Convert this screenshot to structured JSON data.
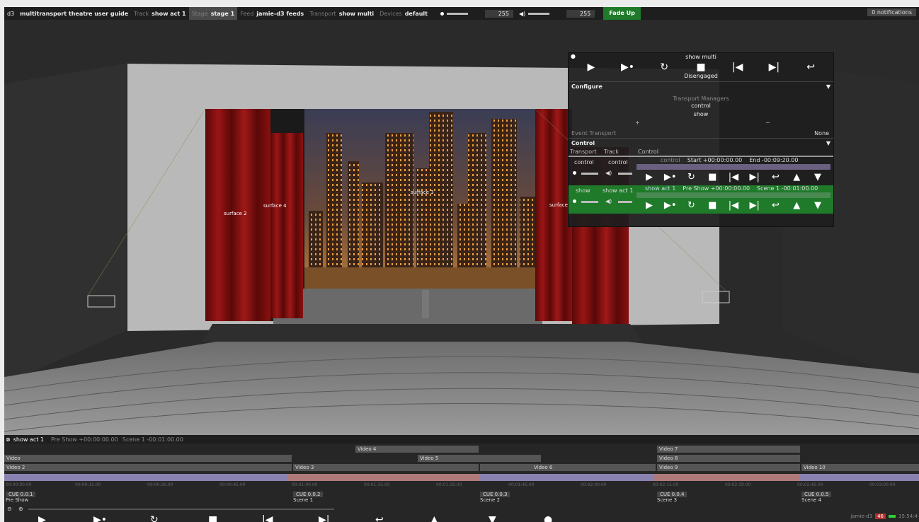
{
  "topbar": {
    "app": "d3",
    "project": "multitransport theatre user guide",
    "track_label": "Track",
    "track_value": "show act 1",
    "stage_label": "Stage",
    "stage_value": "stage 1",
    "feed_label": "Feed",
    "feed_value": "jamie-d3 feeds",
    "transport_label": "Transport",
    "transport_value": "show multi",
    "devices_label": "Devices",
    "devices_value": "default",
    "brightness_value": "255",
    "volume_value": "255",
    "fade_up_label": "Fade Up",
    "notifications": "0 notifications"
  },
  "stage": {
    "surfaces": [
      "surface 2",
      "surface 4",
      "surface 3",
      "surface"
    ]
  },
  "transport_panel": {
    "title": "show multi",
    "status": "Disengaged",
    "configure_label": "Configure",
    "managers_label": "Transport Managers",
    "managers": [
      "control",
      "show"
    ],
    "add_symbol": "+",
    "remove_symbol": "−",
    "event_transport_label": "Event Transport",
    "event_transport_value": "None",
    "control_label": "Control",
    "col_headers": [
      "Transport",
      "Track",
      "Control"
    ],
    "rows": [
      {
        "transport": "control",
        "track": "control",
        "control": "control",
        "start": "Start +00:00:00.00",
        "end": "End -00:09:20.00",
        "active": false
      },
      {
        "transport": "show",
        "track": "show act 1",
        "control": "show act 1",
        "start": "Pre Show +00:00:00.00",
        "end": "Scene 1 -00:01:00.00",
        "active": true
      }
    ],
    "colors": {
      "active_row": "#1f7a2a"
    }
  },
  "timeline": {
    "track_name": "show act 1",
    "position": "Pre Show +00:00:00.00",
    "next": "Scene 1 -00:01:00.00",
    "layers": [
      {
        "name": "Video 4"
      },
      {
        "name": "Video"
      },
      {
        "name": "Video 5"
      },
      {
        "name": "Video 7"
      },
      {
        "name": "Video 8"
      },
      {
        "name": "Video 2"
      },
      {
        "name": "Video 3"
      },
      {
        "name": "Video 6"
      },
      {
        "name": "Video 9"
      },
      {
        "name": "Video 10"
      }
    ],
    "ticks": [
      "00:00:00.00",
      "00:00:15.00",
      "00:00:30.00",
      "00:00:45.00",
      "00:01:00.00",
      "00:01:15.00",
      "00:01:30.00",
      "00:01:45.00",
      "00:02:00.00",
      "00:02:15.00",
      "00:02:30.00",
      "00:02:45.00",
      "00:03:00.00"
    ],
    "cues": [
      {
        "cue": "CUE 0.0.1",
        "name": "Pre Show"
      },
      {
        "cue": "CUE 0.0.2",
        "name": "Scene 1"
      },
      {
        "cue": "CUE 0.0.3",
        "name": "Scene 2"
      },
      {
        "cue": "CUE 0.0.4",
        "name": "Scene 3"
      },
      {
        "cue": "CUE 0.0.5",
        "name": "Scene 4"
      }
    ],
    "machine": "jamie-d3",
    "fps": "46",
    "clock": "15:54:4"
  }
}
